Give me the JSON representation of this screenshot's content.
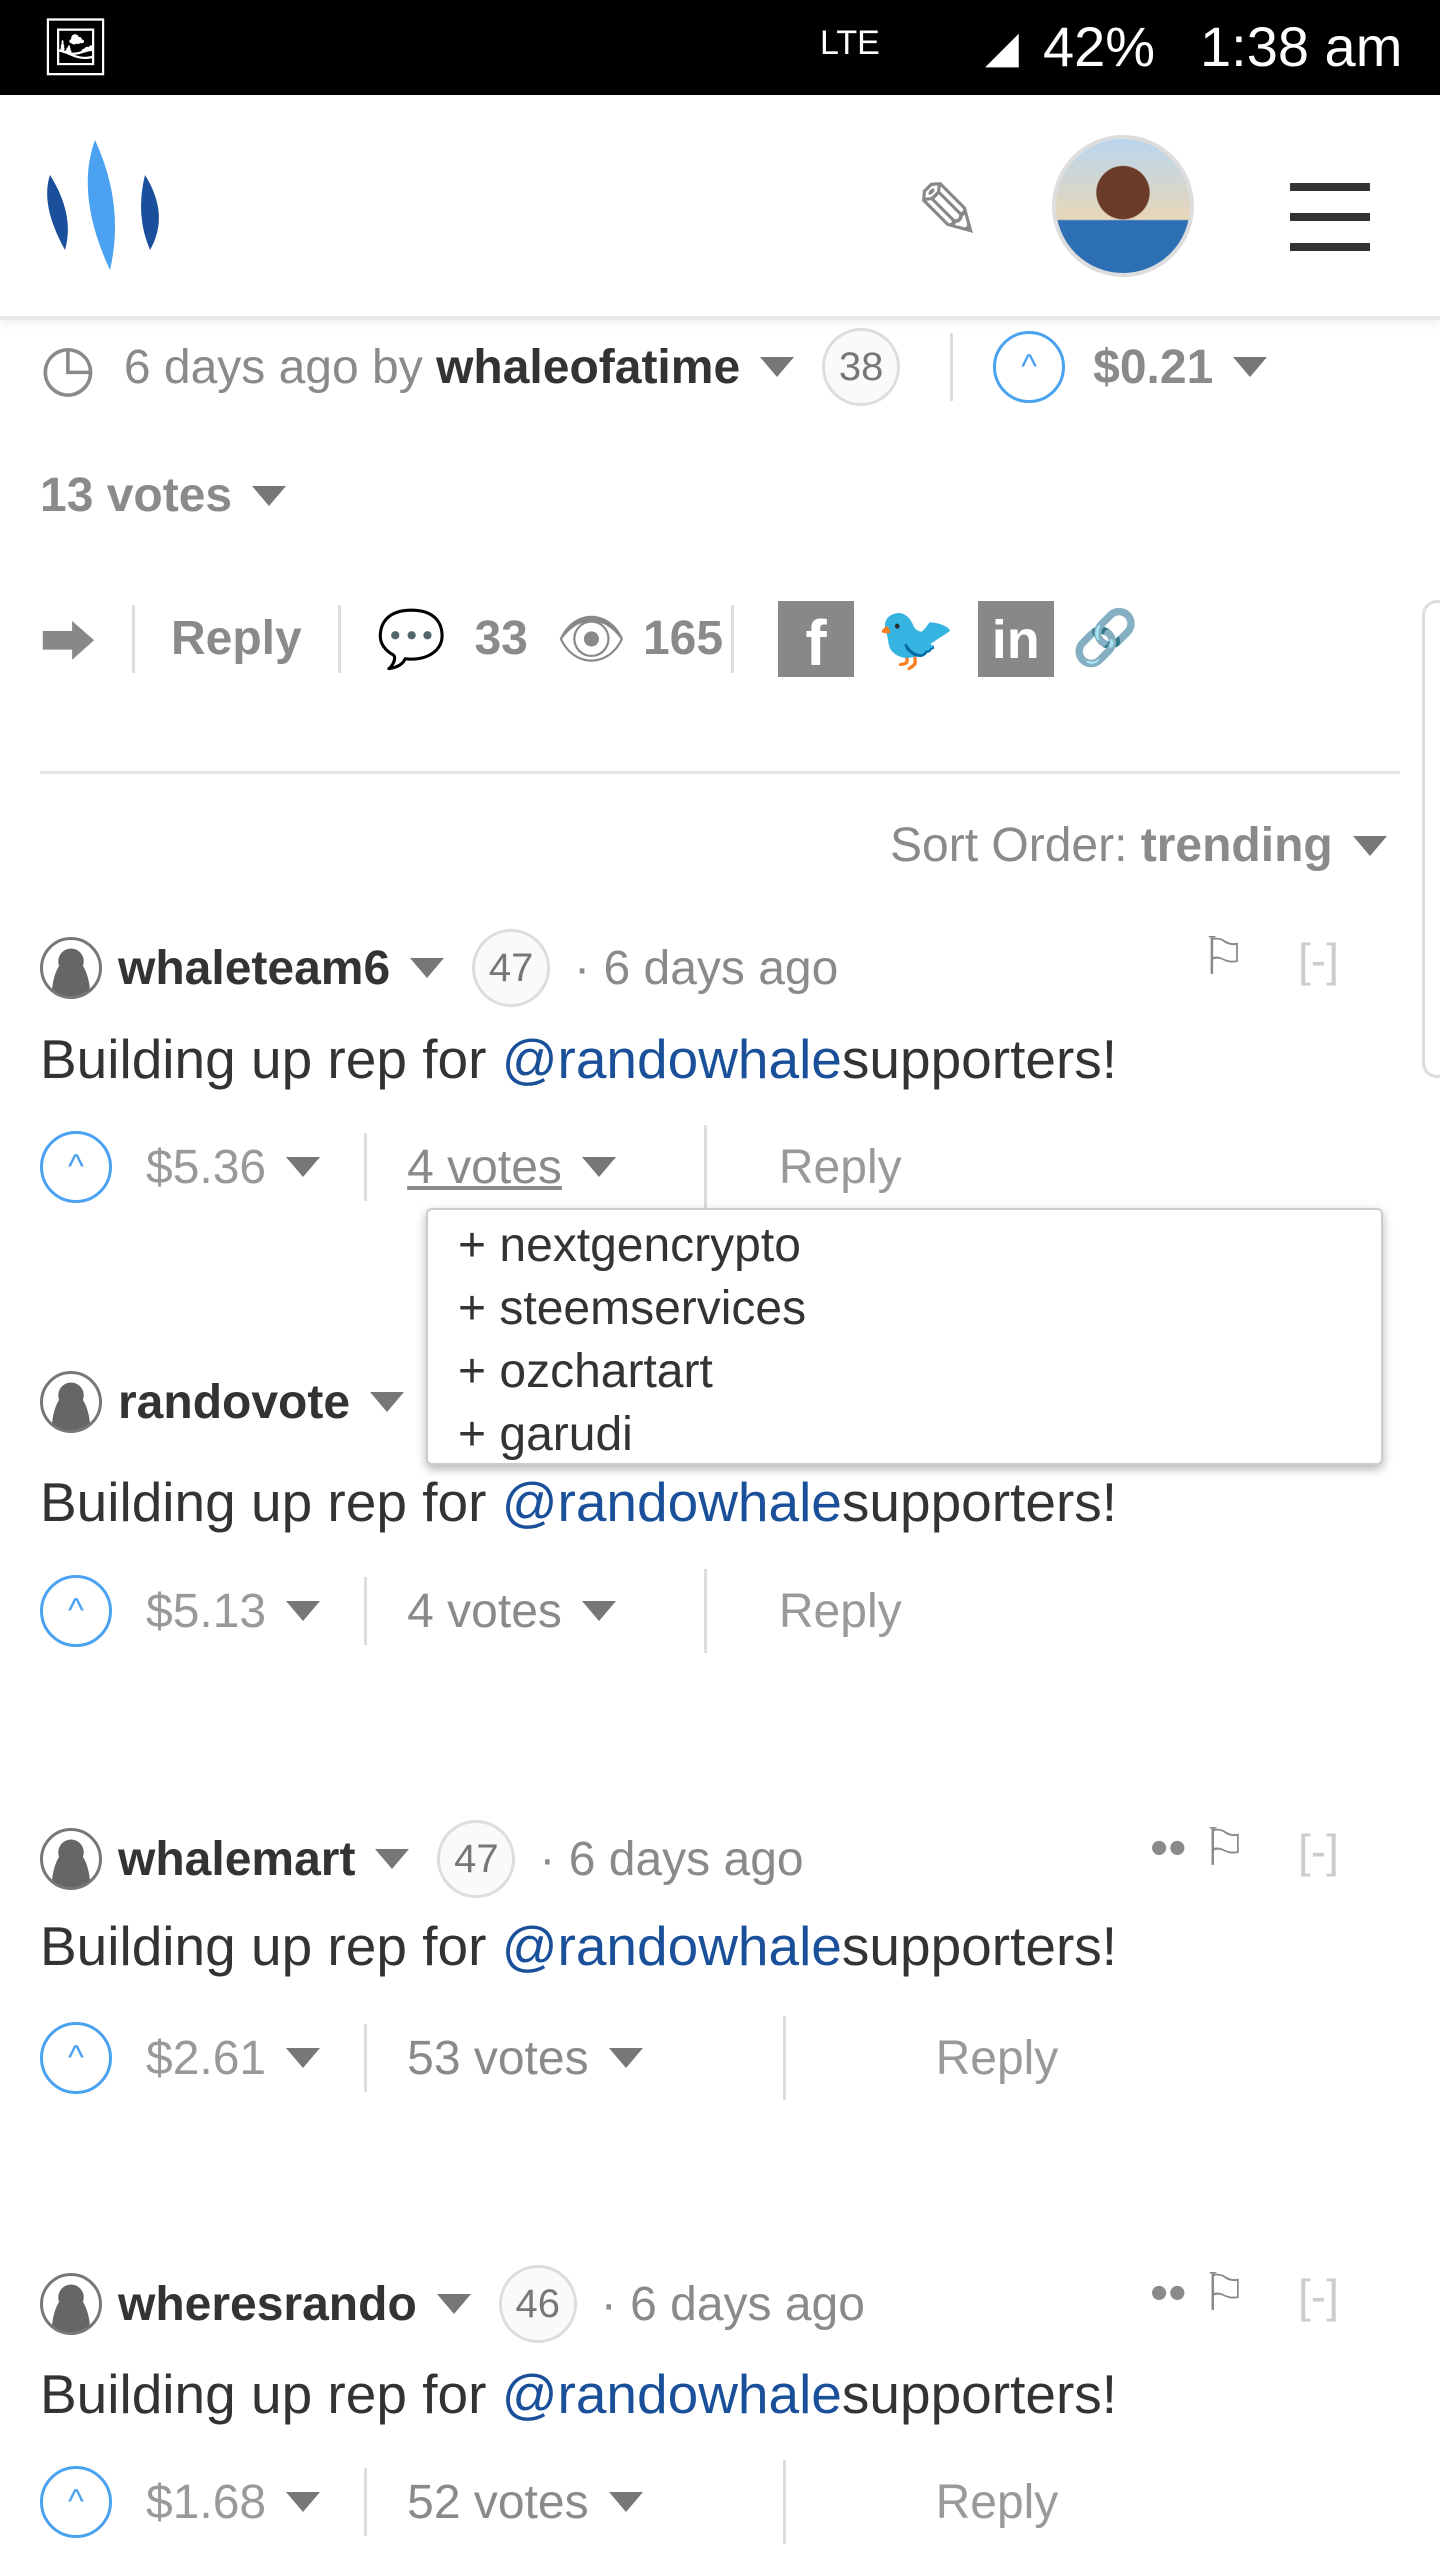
{
  "status_bar": {
    "battery": "42%",
    "time": "1:38 am",
    "network": "LTE"
  },
  "header": {
    "logo": "steemit-logo",
    "edit_icon": "pencil-icon",
    "menu_icon": "hamburger-icon"
  },
  "post": {
    "time": "6 days ago by",
    "author": "whaleofatime",
    "reputation": "38",
    "payout": "$0.21",
    "votes": "13 votes",
    "reply": "Reply",
    "comments": "33",
    "views": "165"
  },
  "sort": {
    "label": "Sort Order:",
    "value": "trending"
  },
  "comments": [
    {
      "author": "whaleteam6",
      "rep": "47",
      "time": "· 6 days ago",
      "body_pre": "Building up rep for ",
      "mention": "@randowhale",
      "body_post": " supporters!",
      "payout": "$5.36",
      "votes": "4 votes",
      "reply": "Reply",
      "collapse": "[-]"
    },
    {
      "author": "randovote",
      "rep": "",
      "time": "",
      "body_pre": "Building up rep for ",
      "mention": "@randowhale",
      "body_post": " supporters!",
      "payout": "$5.13",
      "votes": "4 votes",
      "reply": "Reply",
      "collapse": ""
    },
    {
      "author": "whalemart",
      "rep": "47",
      "time": "· 6 days ago",
      "body_pre": "Building up rep for ",
      "mention": "@randowhale",
      "body_post": " supporters!",
      "payout": "$2.61",
      "votes": "53 votes",
      "reply": "Reply",
      "collapse": "[-]"
    },
    {
      "author": "wheresrando",
      "rep": "46",
      "time": "· 6 days ago",
      "body_pre": "Building up rep for ",
      "mention": "@randowhale",
      "body_post": " supporters!",
      "payout": "$1.68",
      "votes": "52 votes",
      "reply": "Reply",
      "collapse": "[-]"
    }
  ],
  "voters_dropdown": [
    "+ nextgencrypto",
    "+ steemservices",
    "+ ozchartart",
    "+ garudi"
  ],
  "colors": {
    "accent": "#4aa2f0",
    "link": "#1a5099",
    "logo_dark": "#1a4f9c",
    "logo_light": "#4aa2f0"
  }
}
